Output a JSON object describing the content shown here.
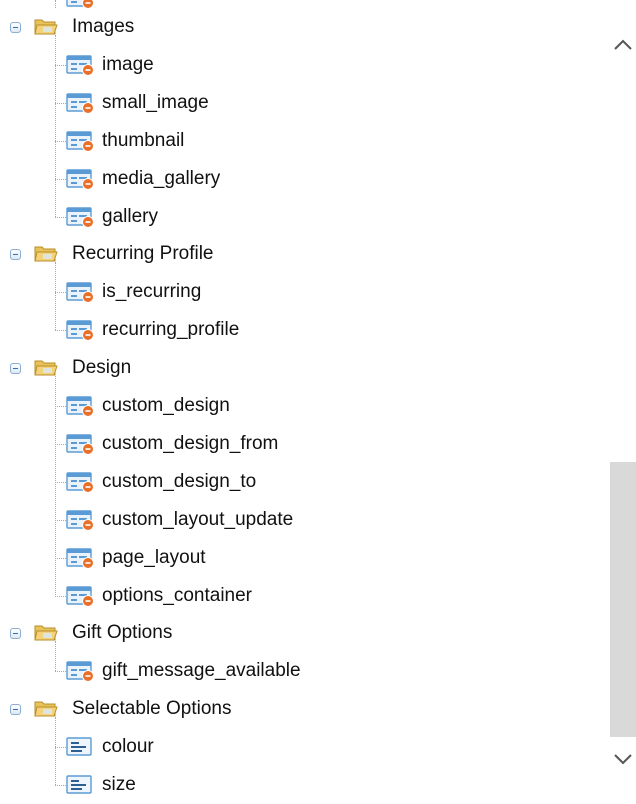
{
  "tree": {
    "groups": [
      {
        "label": "Images",
        "children": [
          {
            "label": "image",
            "icon": "attribute-field-icon"
          },
          {
            "label": "small_image",
            "icon": "attribute-field-icon"
          },
          {
            "label": "thumbnail",
            "icon": "attribute-field-icon"
          },
          {
            "label": "media_gallery",
            "icon": "attribute-field-icon"
          },
          {
            "label": "gallery",
            "icon": "attribute-field-icon"
          }
        ]
      },
      {
        "label": "Recurring Profile",
        "children": [
          {
            "label": "is_recurring",
            "icon": "attribute-field-icon"
          },
          {
            "label": "recurring_profile",
            "icon": "attribute-field-icon"
          }
        ]
      },
      {
        "label": "Design",
        "children": [
          {
            "label": "custom_design",
            "icon": "attribute-field-icon"
          },
          {
            "label": "custom_design_from",
            "icon": "attribute-field-icon"
          },
          {
            "label": "custom_design_to",
            "icon": "attribute-field-icon"
          },
          {
            "label": "custom_layout_update",
            "icon": "attribute-field-icon"
          },
          {
            "label": "page_layout",
            "icon": "attribute-field-icon"
          },
          {
            "label": "options_container",
            "icon": "attribute-field-icon"
          }
        ]
      },
      {
        "label": "Gift Options",
        "children": [
          {
            "label": "gift_message_available",
            "icon": "attribute-field-icon"
          }
        ]
      },
      {
        "label": "Selectable Options",
        "children": [
          {
            "label": "colour",
            "icon": "option-field-icon"
          },
          {
            "label": "size",
            "icon": "option-field-icon"
          }
        ]
      }
    ]
  },
  "colors": {
    "field_icon_blue": "#5b9bd5",
    "field_icon_badge": "#e8702a",
    "folder_yellow": "#f4d27a",
    "scrollbar_thumb": "#d9d9d9"
  }
}
